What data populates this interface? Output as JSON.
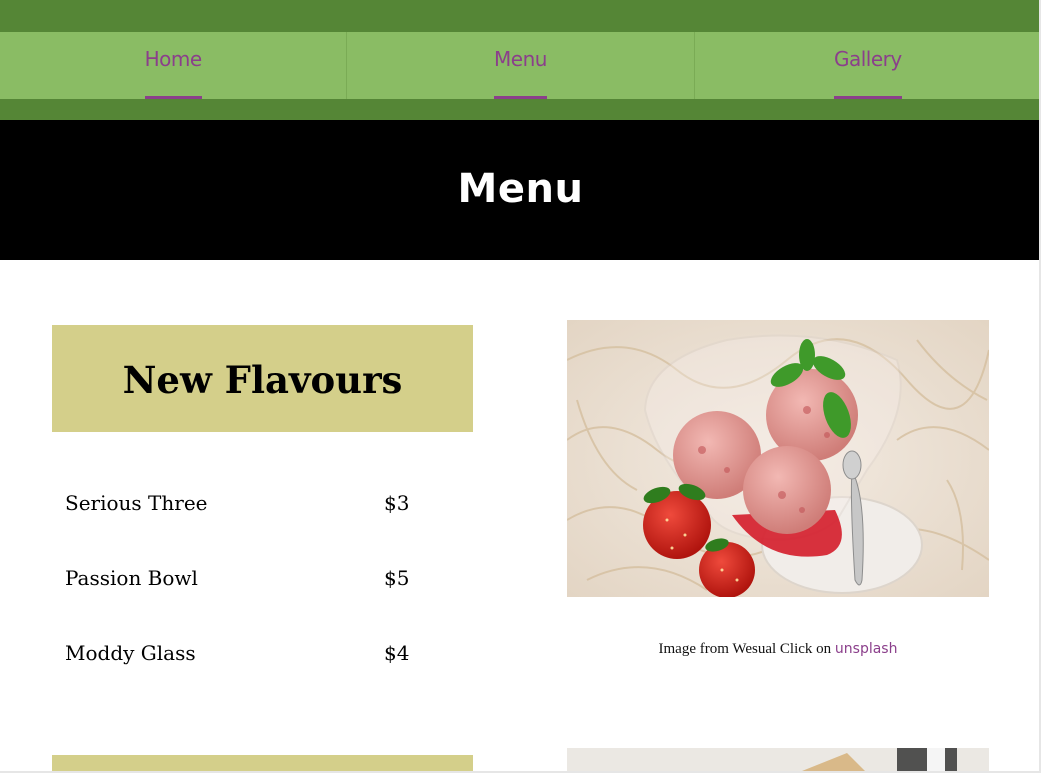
{
  "nav": {
    "items": [
      {
        "label": "Home"
      },
      {
        "label": "Menu"
      },
      {
        "label": "Gallery"
      }
    ],
    "accent_color": "#8b3f8b",
    "bar_color": "#8abc64",
    "strip_color": "#558636"
  },
  "banner": {
    "title": "Menu"
  },
  "section": {
    "title": "New Flavours",
    "items": [
      {
        "name": "Serious Three",
        "price": "$3"
      },
      {
        "name": "Passion Bowl",
        "price": "$5"
      },
      {
        "name": "Moddy Glass",
        "price": "$4"
      }
    ],
    "header_color": "#d4cf8a"
  },
  "photo": {
    "caption_prefix": "Image from Wesual Click on ",
    "caption_link": "unsplash",
    "subject": "strawberry-ice-cream-bowl-image"
  }
}
